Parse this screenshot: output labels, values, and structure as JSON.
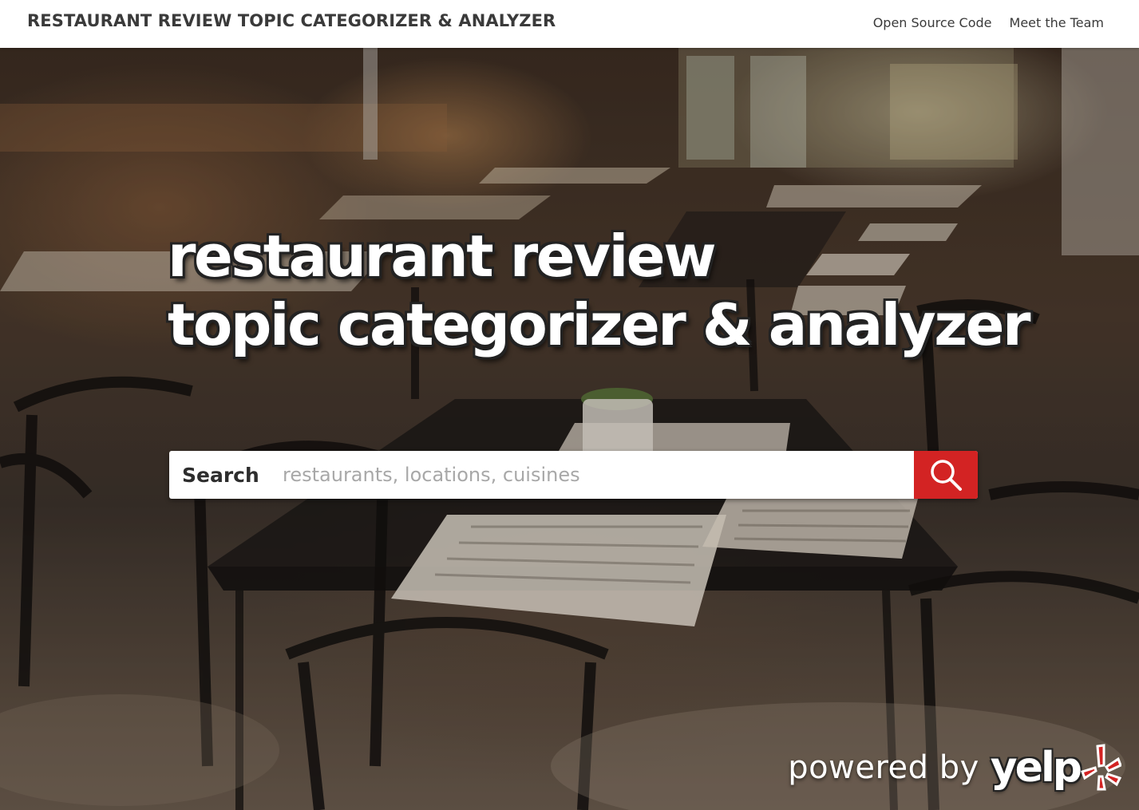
{
  "navbar": {
    "brand": "RESTAURANT REVIEW TOPIC CATEGORIZER & ANALYZER",
    "links": [
      {
        "label": "Open Source Code"
      },
      {
        "label": "Meet the Team"
      }
    ]
  },
  "hero": {
    "headline_line1": "restaurant review",
    "headline_line2": "topic categorizer & analyzer"
  },
  "search": {
    "label": "Search",
    "value": "",
    "placeholder": "restaurants, locations, cuisines",
    "button_icon": "search-icon"
  },
  "footer": {
    "powered_by": "powered by",
    "logo_wordmark": "yelp"
  },
  "colors": {
    "navbar_bg": "#ffffff",
    "nav_text": "#3a3a3a",
    "search_button": "#d32323",
    "yelp_burst": "#d32323",
    "headline_text": "#ffffff"
  }
}
